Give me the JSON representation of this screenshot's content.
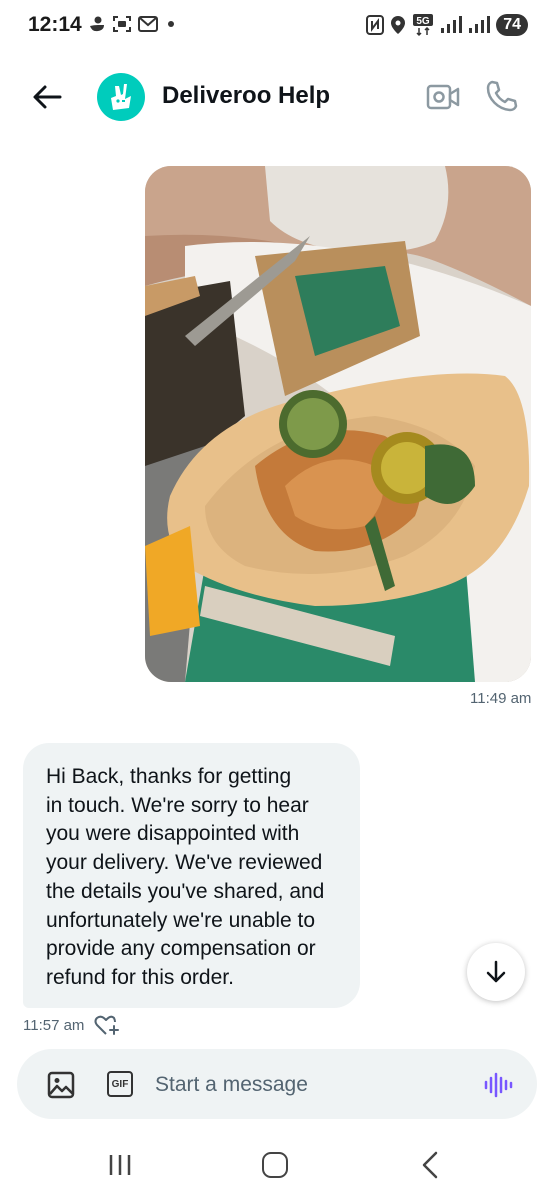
{
  "status_bar": {
    "time": "12:14",
    "network": "5G",
    "battery": "74",
    "left_icons": [
      "duck-icon",
      "screenshot-icon",
      "mail-icon",
      "dot-icon"
    ],
    "right_icons": [
      "nfc-icon",
      "location-icon",
      "5g-icon",
      "signal-icon",
      "signal-icon",
      "battery-icon"
    ]
  },
  "header": {
    "title": "Deliveroo Help",
    "avatar_color": "#00ccbc"
  },
  "messages": [
    {
      "type": "image",
      "side": "sent",
      "time": "11:49 am"
    },
    {
      "type": "text",
      "side": "received",
      "time": "11:57 am",
      "lines": [
        "Hi Back, thanks for getting",
        "in touch. We're sorry to hear",
        "you were disappointed with",
        "your delivery. We've reviewed",
        "the details you've shared, and",
        "unfortunately we're unable to",
        "provide any compensation or",
        "refund for this order."
      ]
    }
  ],
  "composer": {
    "placeholder": "Start a message",
    "gif_label": "GIF",
    "accent": "#7856ff"
  }
}
